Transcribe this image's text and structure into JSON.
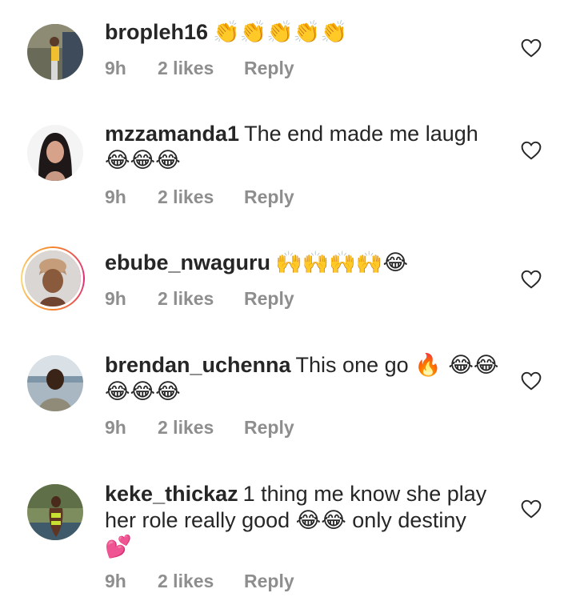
{
  "comments": [
    {
      "username": "bropleh16",
      "text": "",
      "emoji": "👏👏👏👏👏",
      "time": "9h",
      "likes": "2 likes",
      "reply": "Reply"
    },
    {
      "username": "mzzamanda1",
      "text": "The end made me laugh",
      "emoji": "😂😂😂",
      "time": "9h",
      "likes": "2 likes",
      "reply": "Reply"
    },
    {
      "username": "ebube_nwaguru",
      "text": "",
      "emoji": "🙌🙌🙌🙌😂",
      "time": "9h",
      "likes": "2 likes",
      "reply": "Reply"
    },
    {
      "username": "brendan_uchenna",
      "text": "This one go",
      "emoji": "🔥 😂😂",
      "emoji2": "😂😂😂",
      "time": "9h",
      "likes": "2 likes",
      "reply": "Reply"
    },
    {
      "username": "keke_thickaz",
      "text": "1 thing me know she play her role really good",
      "emoji": "😂😂",
      "text2": "only destiny",
      "emoji2": "💕",
      "time": "9h",
      "likes": "2 likes",
      "reply": "Reply"
    }
  ],
  "icons": {
    "like": "heart-outline-icon"
  },
  "colors": {
    "text": "#262626",
    "muted": "#8e8e8e",
    "story_ring": "#dd2a7b"
  }
}
